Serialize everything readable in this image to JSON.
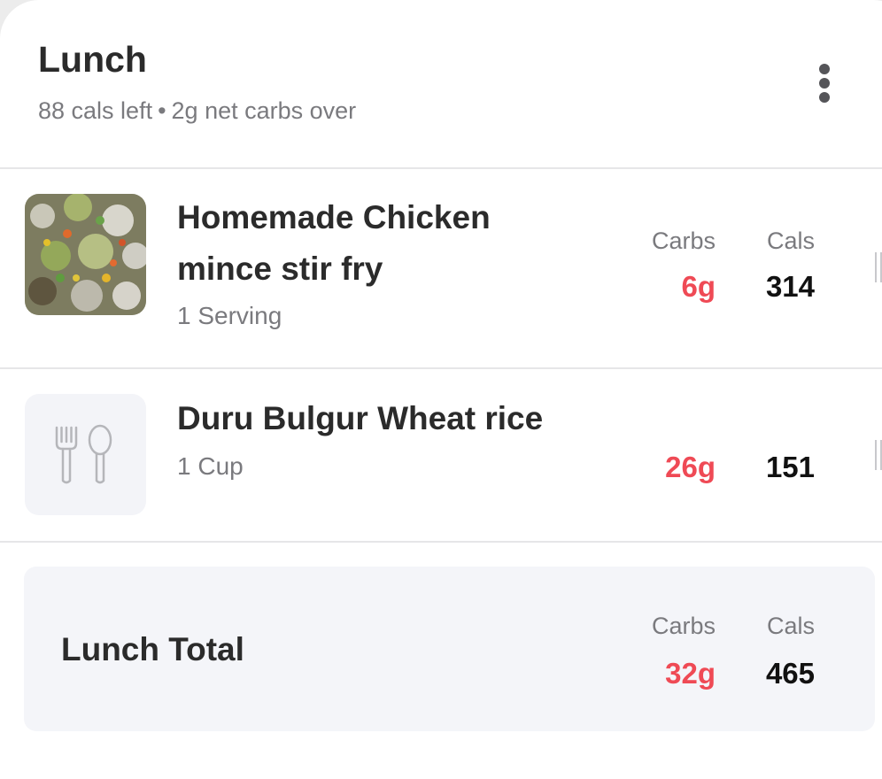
{
  "meal": {
    "title": "Lunch",
    "cals_left": "88 cals left",
    "separator": "•",
    "net_carbs": "2g net carbs over"
  },
  "columns": {
    "carbs": "Carbs",
    "cals": "Cals"
  },
  "items": [
    {
      "name": "Homemade Chicken mince stir fry",
      "serving": "1 Serving",
      "carbs": "6g",
      "cals": "314",
      "image": "food-photo"
    },
    {
      "name": "Duru Bulgur Wheat rice",
      "serving": "1 Cup",
      "carbs": "26g",
      "cals": "151",
      "image": "fork-spoon-icon"
    }
  ],
  "total": {
    "label": "Lunch Total",
    "carbs": "32g",
    "cals": "465"
  },
  "colors": {
    "carbs_value": "#ef4a55",
    "cals_value": "#111111",
    "muted_text": "#7a7a7e",
    "total_bg": "#f4f5f9"
  }
}
